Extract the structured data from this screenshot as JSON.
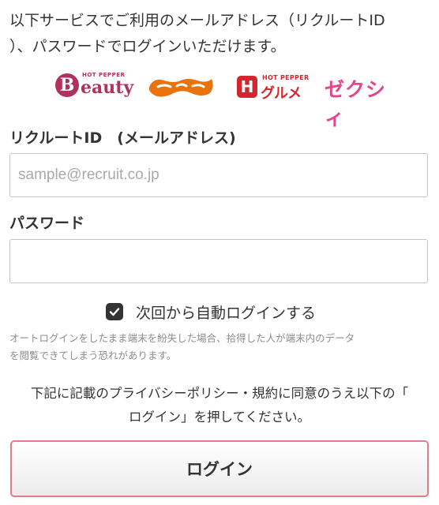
{
  "intro": {
    "text": "以下サービスでご利用のメールアドレス（リクルートID\n）、パスワードでログインいただけます。"
  },
  "logos": {
    "beauty": {
      "small": "HOT PEPPER",
      "emblem": "B",
      "word": "eauty",
      "color": "#b2305e"
    },
    "jalan": {
      "icon": "jalan-logo-icon",
      "color": "#e8730c"
    },
    "gourmet": {
      "small": "HOT PEPPER",
      "emblem": "H",
      "word": "グルメ",
      "color": "#d3262e"
    },
    "zexy": {
      "word": "ゼクシィ",
      "color": "#e2458c"
    }
  },
  "form": {
    "id_label": "リクルートID　(メールアドレス)",
    "id_placeholder": "sample@recruit.co.jp",
    "id_value": "",
    "password_label": "パスワード",
    "password_value": "",
    "auto_login_label": "次回から自動ログインする",
    "auto_login_checked": true
  },
  "warning": {
    "text": "オートログインをしたまま端末を紛失した場合、拾得した人が端末内のデータ\nを閲覧できてしまう恐れがあります。"
  },
  "notice": {
    "text": "下記に記載のプライバシーポリシー・規約に同意のうえ以下の「\nログイン」を押してください。"
  },
  "login_button": {
    "label": "ログイン",
    "border_color": "#e07d8c"
  }
}
